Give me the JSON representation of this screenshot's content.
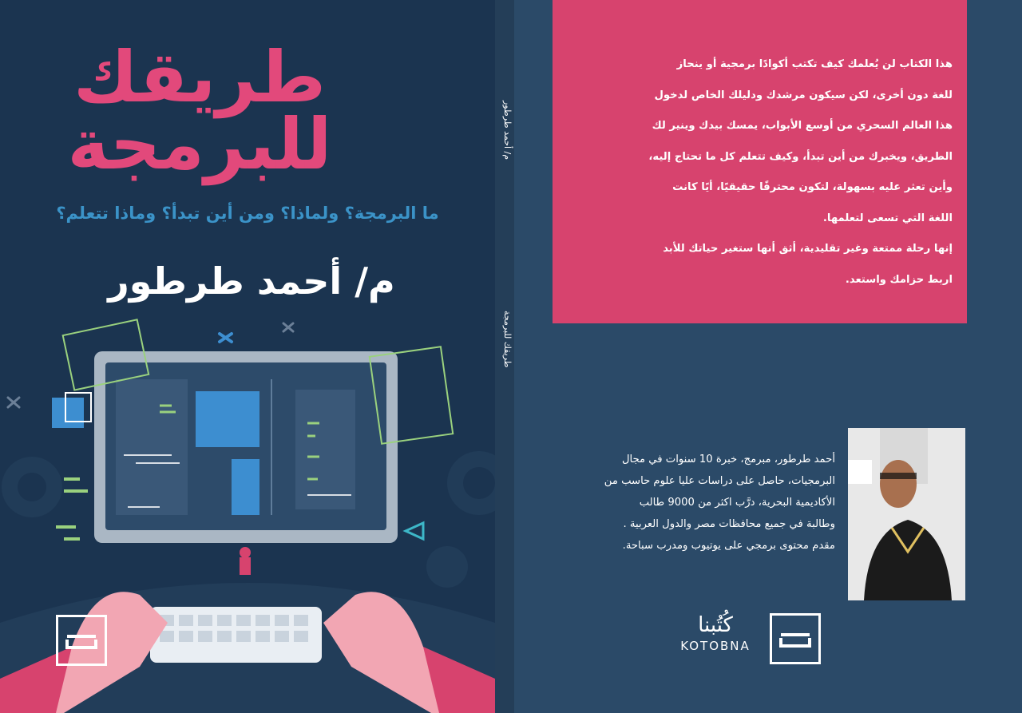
{
  "front": {
    "title": "طريقك للبرمجة",
    "subtitle": "ما البرمجة؟ ولماذا؟ ومن أين تبدأ؟ وماذا تتعلم؟",
    "author": "م/ أحمد طرطور"
  },
  "spine": {
    "author": "م/ أحمد طرطور",
    "title": "طريقك للبرمجة"
  },
  "back": {
    "blurb_lines": [
      "هذا الكتاب لن يُعلمك كيف تكتب أكوادًا برمجية أو ينحاز",
      "للغة دون أخرى، لكن سيكون مرشدك ودليلك الخاص لدخول",
      "هذا العالم السحري من أوسع الأبواب، يمسك بيدك وينير لك",
      "الطريق، ويخبرك من أين تبدأ، وكيف تتعلم كل ما تحتاج إليه،",
      "وأين تعثر عليه بسهولة، لتكون محترفًا حقيقيًا، أيًا كانت",
      "اللغة التي تسعى لتعلمها.",
      "إنها رحلة ممتعة وغير تقليدية، أثق أنها ستغير حياتك للأبد",
      "اربط حزامك واستعد."
    ],
    "bio_lines": [
      "أحمد طرطور، مبرمج، خبرة 10 سنوات في مجال",
      "البرمجيات، حاصل على دراسات عليا علوم حاسب من",
      "الأكاديمية البحرية، درَّب اكثر من 9000 طالب",
      "وطالبة في جميع محافظات مصر والدول العربية .",
      "مقدم محتوى برمجي على يوتيوب ومدرب سباحة."
    ],
    "publisher_ar": "كُتُبنا",
    "publisher_en": "KOTOBNA"
  },
  "colors": {
    "front_bg": "#1b3450",
    "back_bg": "#2b4a68",
    "accent_pink": "#d7436e",
    "title_pink": "#e2497b",
    "subtitle_blue": "#3b93c8"
  }
}
